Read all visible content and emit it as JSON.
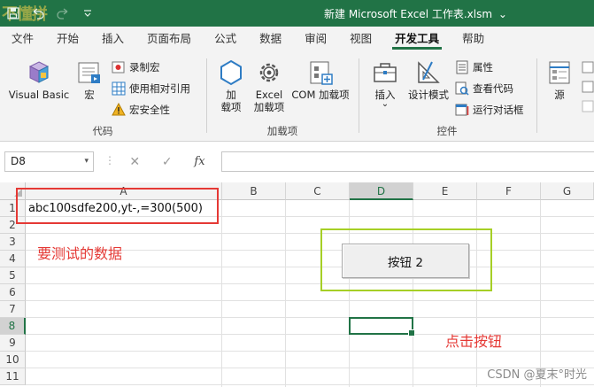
{
  "window": {
    "title": "新建 Microsoft Excel 工作表.xlsm",
    "title_chevron": "⌄",
    "qat": {
      "save_icon": "save-icon",
      "undo_icon": "undo-icon",
      "redo_icon": "redo-icon"
    },
    "corner_watermark": "不懂拼"
  },
  "tabs": [
    "文件",
    "开始",
    "插入",
    "页面布局",
    "公式",
    "数据",
    "审阅",
    "视图",
    "开发工具",
    "帮助"
  ],
  "active_tab": "开发工具",
  "ribbon": {
    "code_group": {
      "label": "代码",
      "visual_basic": "Visual Basic",
      "macros": "宏",
      "record_macro": "录制宏",
      "relative_refs": "使用相对引用",
      "macro_security": "宏安全性"
    },
    "addins_group": {
      "label": "加载项",
      "addins_line1": "加",
      "addins_line2": "载项",
      "excel_addins_line1": "Excel",
      "excel_addins_line2": "加载项",
      "com_addins": "COM 加载项"
    },
    "controls_group": {
      "label": "控件",
      "insert": "插入",
      "insert_dropdown": "⌄",
      "design_mode": "设计模式",
      "properties": "属性",
      "view_code": "查看代码",
      "run_dialog": "运行对话框"
    },
    "xml_group": {
      "source": "源"
    }
  },
  "formula_bar": {
    "name_box": "D8",
    "name_box_dropdown": "▾",
    "separator": "⋮",
    "cancel_icon": "✕",
    "enter_icon": "✓",
    "fx_label": "fx",
    "formula": ""
  },
  "sheet": {
    "columns": [
      "A",
      "B",
      "C",
      "D",
      "E",
      "F",
      "G"
    ],
    "rows": [
      "1",
      "2",
      "3",
      "4",
      "5",
      "6",
      "7",
      "8",
      "9",
      "10",
      "11"
    ],
    "selected_cell": "D8",
    "cell_a1": "abc100sdfe200,yt-,=300(500)",
    "button_label": "按钮 2"
  },
  "annotations": {
    "data_label": "要测试的数据",
    "click_label": "点击按钮",
    "highlight_red": "#e53935",
    "highlight_green": "#a6cf26"
  },
  "credit": "CSDN @夏末°时光",
  "colors": {
    "excel_green": "#217346"
  }
}
